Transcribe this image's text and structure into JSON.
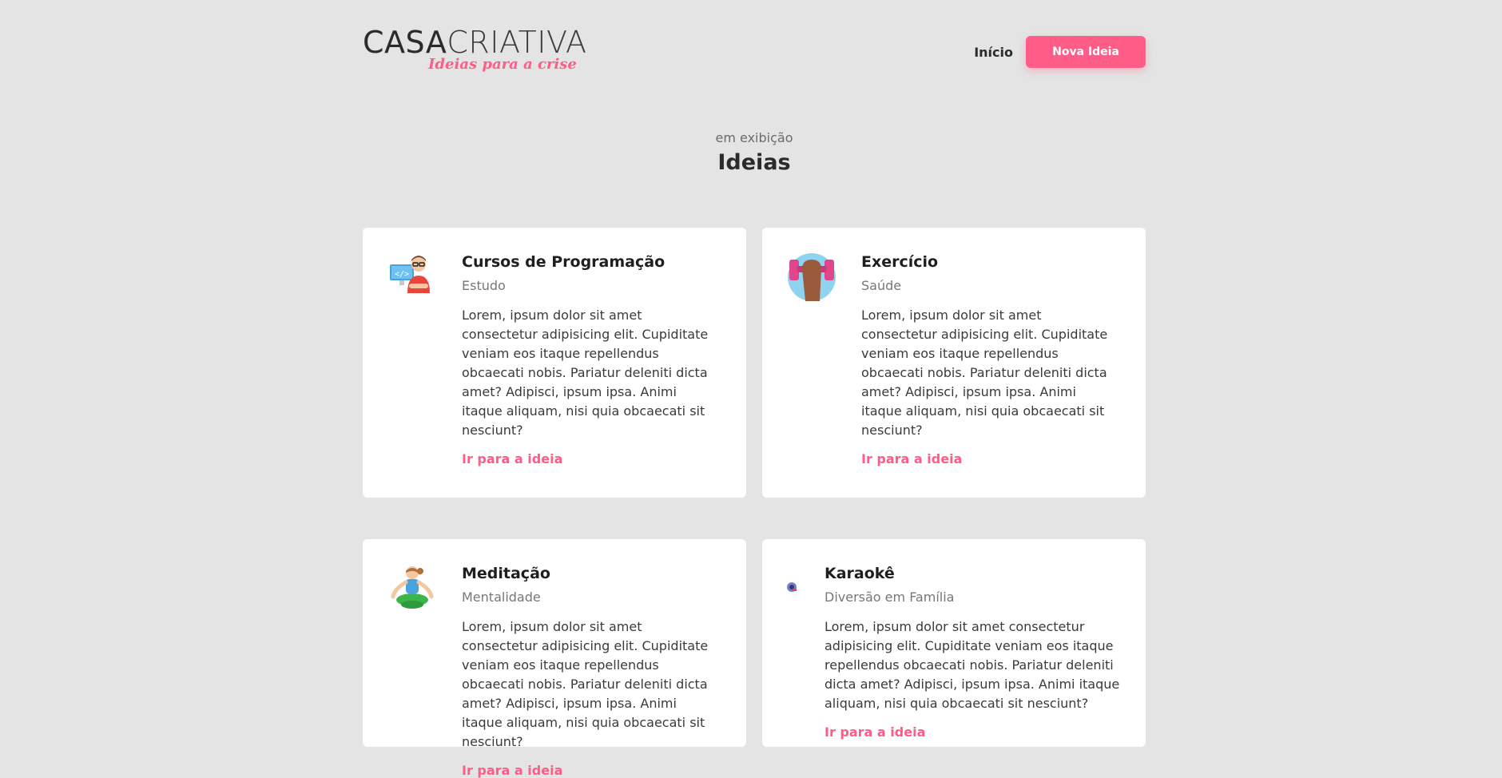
{
  "header": {
    "logo_bold": "CASA",
    "logo_light": "CRIATIVA",
    "logo_tagline": "Ideias para a crise",
    "nav_home": "Início",
    "new_button": "Nova Ideia"
  },
  "section": {
    "subtitle": "em exibição",
    "title": "Ideias"
  },
  "colors": {
    "accent": "#ff5c87",
    "background": "#e4e4e4",
    "card": "#ffffff"
  },
  "ideas": [
    {
      "title": "Cursos de Programação",
      "category": "Estudo",
      "description": "Lorem, ipsum dolor sit amet consectetur adipisicing elit. Cupiditate veniam eos itaque repellendus obcaecati nobis. Pariatur deleniti dicta amet? Adipisci, ipsum ipsa. Animi itaque aliquam, nisi quia obcaecati sit nesciunt?",
      "link": "Ir para a ideia",
      "icon": "programmer-icon"
    },
    {
      "title": "Exercício",
      "category": "Saúde",
      "description": "Lorem, ipsum dolor sit amet consectetur adipisicing elit. Cupiditate veniam eos itaque repellendus obcaecati nobis. Pariatur deleniti dicta amet? Adipisci, ipsum ipsa. Animi itaque aliquam, nisi quia obcaecati sit nesciunt?",
      "link": "Ir para a ideia",
      "icon": "dumbbell-icon"
    },
    {
      "title": "Meditação",
      "category": "Mentalidade",
      "description": "Lorem, ipsum dolor sit amet consectetur adipisicing elit. Cupiditate veniam eos itaque repellendus obcaecati nobis. Pariatur deleniti dicta amet? Adipisci, ipsum ipsa. Animi itaque aliquam, nisi quia obcaecati sit nesciunt?",
      "link": "Ir para a ideia",
      "icon": "meditation-icon"
    },
    {
      "title": "Karaokê",
      "category": "Diversão em Família",
      "description": "Lorem, ipsum dolor sit amet consectetur adipisicing elit. Cupiditate veniam eos itaque repellendus obcaecati nobis. Pariatur deleniti dicta amet? Adipisci, ipsum ipsa. Animi itaque aliquam, nisi quia obcaecati sit nesciunt?",
      "link": "Ir para a ideia",
      "icon": "microphone-icon"
    }
  ]
}
